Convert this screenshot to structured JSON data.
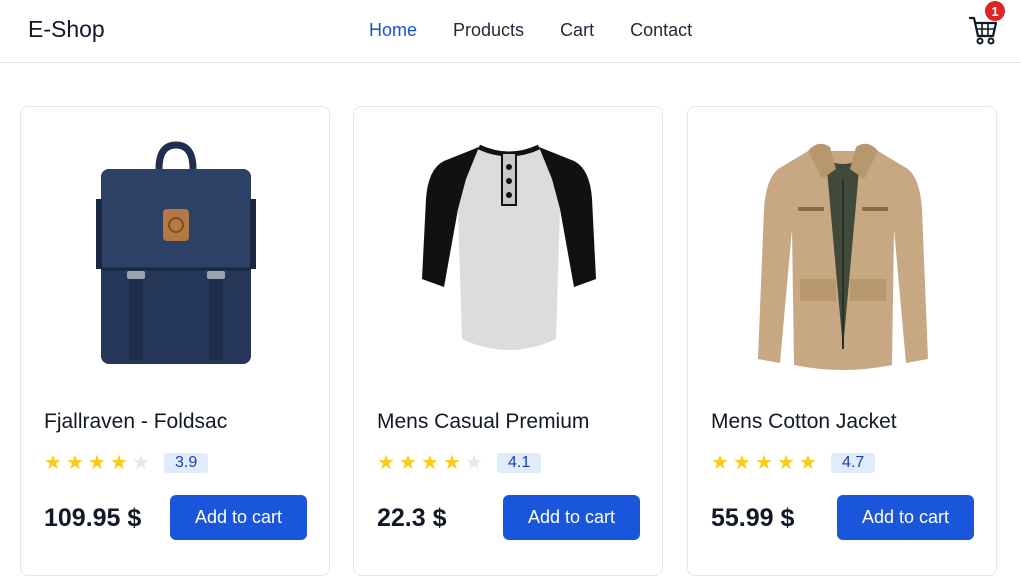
{
  "nav": {
    "brand": "E-Shop",
    "links": [
      {
        "label": "Home"
      },
      {
        "label": "Products"
      },
      {
        "label": "Cart"
      },
      {
        "label": "Contact"
      }
    ],
    "cart_count": "1"
  },
  "products": [
    {
      "title": "Fjallraven - Foldsac",
      "rating": "3.9",
      "stars": 4,
      "price": "109.95 $",
      "button": "Add to cart",
      "image": "backpack-image"
    },
    {
      "title": "Mens Casual Premium",
      "rating": "4.1",
      "stars": 4,
      "price": "22.3 $",
      "button": "Add to cart",
      "image": "raglan-shirt-image"
    },
    {
      "title": "Mens Cotton Jacket",
      "rating": "4.7",
      "stars": 5,
      "price": "55.99 $",
      "button": "Add to cart",
      "image": "jacket-image"
    }
  ],
  "colors": {
    "accent": "#1a56db",
    "star": "#facc15",
    "badge": "#dc2626"
  }
}
